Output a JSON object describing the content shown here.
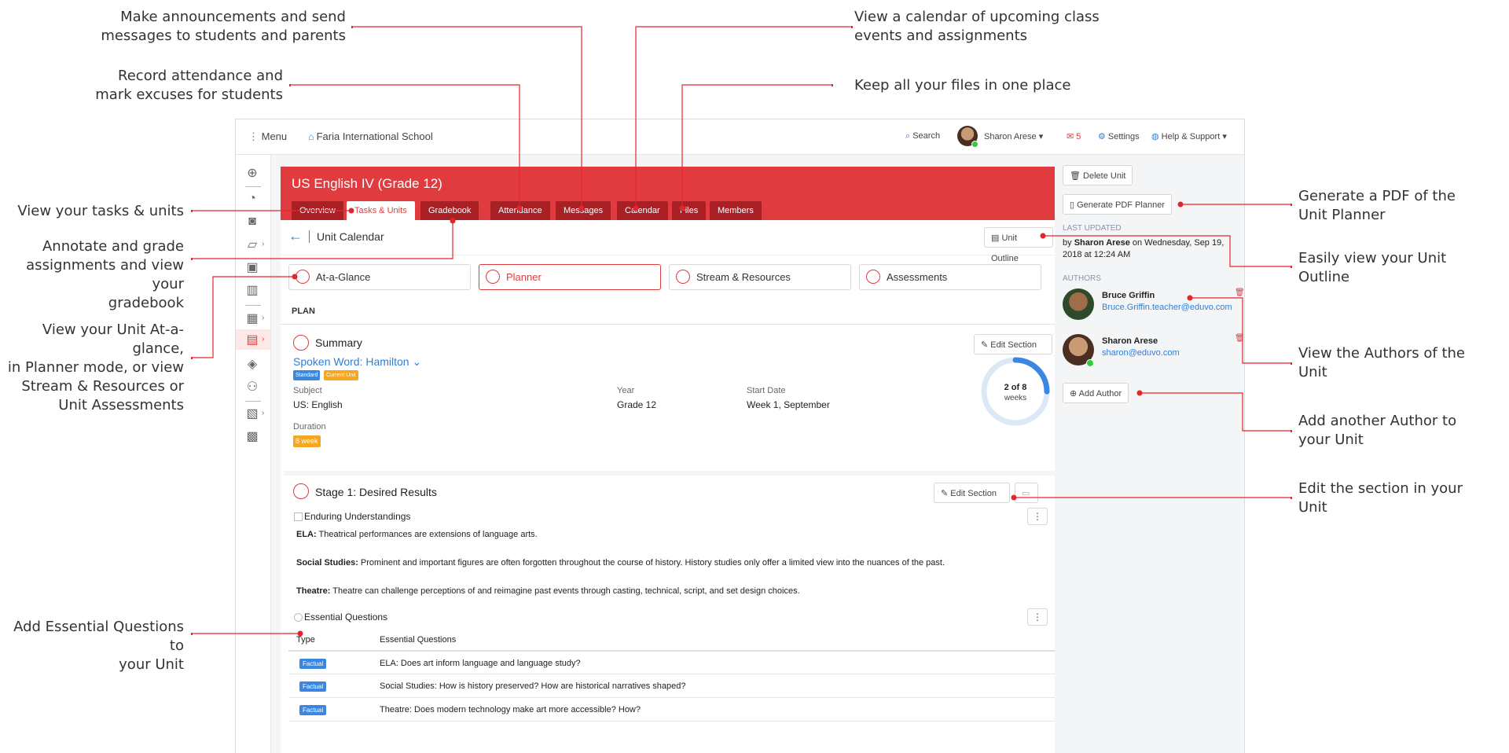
{
  "annotations": {
    "announce": "Make announcements and send\nmessages to students and parents",
    "attendance": "Record attendance and\nmark excuses for students",
    "calendar": "View a calendar of upcoming class\nevents and assignments",
    "files": "Keep all your files in one place",
    "tasks": "View your tasks & units",
    "gradebook": "Annotate and grade\nassignments and view your\ngradebook",
    "unitview": "View your Unit At-a-glance,\nin Planner mode, or view\nStream & Resources or\nUnit Assessments",
    "questions": "Add Essential Questions to\nyour Unit",
    "pdf": "Generate a PDF of the\nUnit Planner",
    "outline": "Easily view your Unit\nOutline",
    "authors": "View the Authors of the\nUnit",
    "addauthor": "Add another Author to\nyour Unit",
    "editsection": "Edit the section in your\nUnit"
  },
  "topbar": {
    "menu": "Menu",
    "school": "Faria International School",
    "search": "Search",
    "user": "Sharon Arese",
    "mail_count": "5",
    "settings": "Settings",
    "help": "Help & Support"
  },
  "unit": {
    "title": "US English IV (Grade 12)",
    "tabs": [
      "Overview",
      "Tasks & Units",
      "Gradebook",
      "Attendance",
      "Messages",
      "Calendar",
      "Files",
      "Members"
    ],
    "calendar_title": "Unit Calendar",
    "outline_btn": "Unit Outline",
    "view_tabs": [
      "At-a-Glance",
      "Planner",
      "Stream & Resources",
      "Assessments"
    ],
    "plan_label": "PLAN"
  },
  "summary": {
    "heading": "Summary",
    "edit": "Edit Section",
    "unit_name": "Spoken Word: Hamilton",
    "tags": [
      "Standard",
      "Current Unit"
    ],
    "subject_label": "Subject",
    "subject": "US: English",
    "year_label": "Year",
    "year": "Grade 12",
    "start_label": "Start Date",
    "start": "Week 1, September",
    "duration_label": "Duration",
    "duration": "8 week",
    "progress_text": "2 of 8",
    "progress_unit": "weeks",
    "progress_fraction": 0.25
  },
  "stage1": {
    "heading": "Stage 1: Desired Results",
    "edit": "Edit Section",
    "eu_label": "Enduring Understandings",
    "eu": [
      {
        "label": "ELA:",
        "text": "Theatrical performances are extensions of language arts."
      },
      {
        "label": "Social Studies:",
        "text": "Prominent and important figures are often forgotten throughout the course of history. History studies only offer a limited view into the nuances of the past."
      },
      {
        "label": "Theatre:",
        "text": "Theatre can challenge perceptions of and reimagine past events through casting, technical, script, and set design choices."
      }
    ],
    "eq_label": "Essential Questions",
    "eq_headers": [
      "Type",
      "Essential Questions"
    ],
    "eq_rows": [
      {
        "type": "Factual",
        "q": "ELA: Does art inform language and language study?"
      },
      {
        "type": "Factual",
        "q": "Social Studies: How is history preserved? How are historical narratives shaped?"
      },
      {
        "type": "Factual",
        "q": "Theatre: Does modern technology make art more accessible? How?"
      }
    ]
  },
  "sidebar": {
    "delete": "Delete Unit",
    "pdf": "Generate PDF Planner",
    "last_updated_label": "LAST UPDATED",
    "updated_prefix": "by",
    "updated_by": "Sharon Arese",
    "updated_line1_rest": "on Wednesday, Sep 19,",
    "updated_line2": "2018 at 12:24 AM",
    "authors_label": "AUTHORS",
    "authors": [
      {
        "name": "Bruce Griffin",
        "email": "Bruce.Griffin.teacher@eduvo.com"
      },
      {
        "name": "Sharon Arese",
        "email": "sharon@eduvo.com"
      }
    ],
    "add_author": "Add Author"
  },
  "colors": {
    "brand_red": "#e03b3f",
    "link_blue": "#2f7fd6",
    "pointer_red": "#e3262d"
  }
}
